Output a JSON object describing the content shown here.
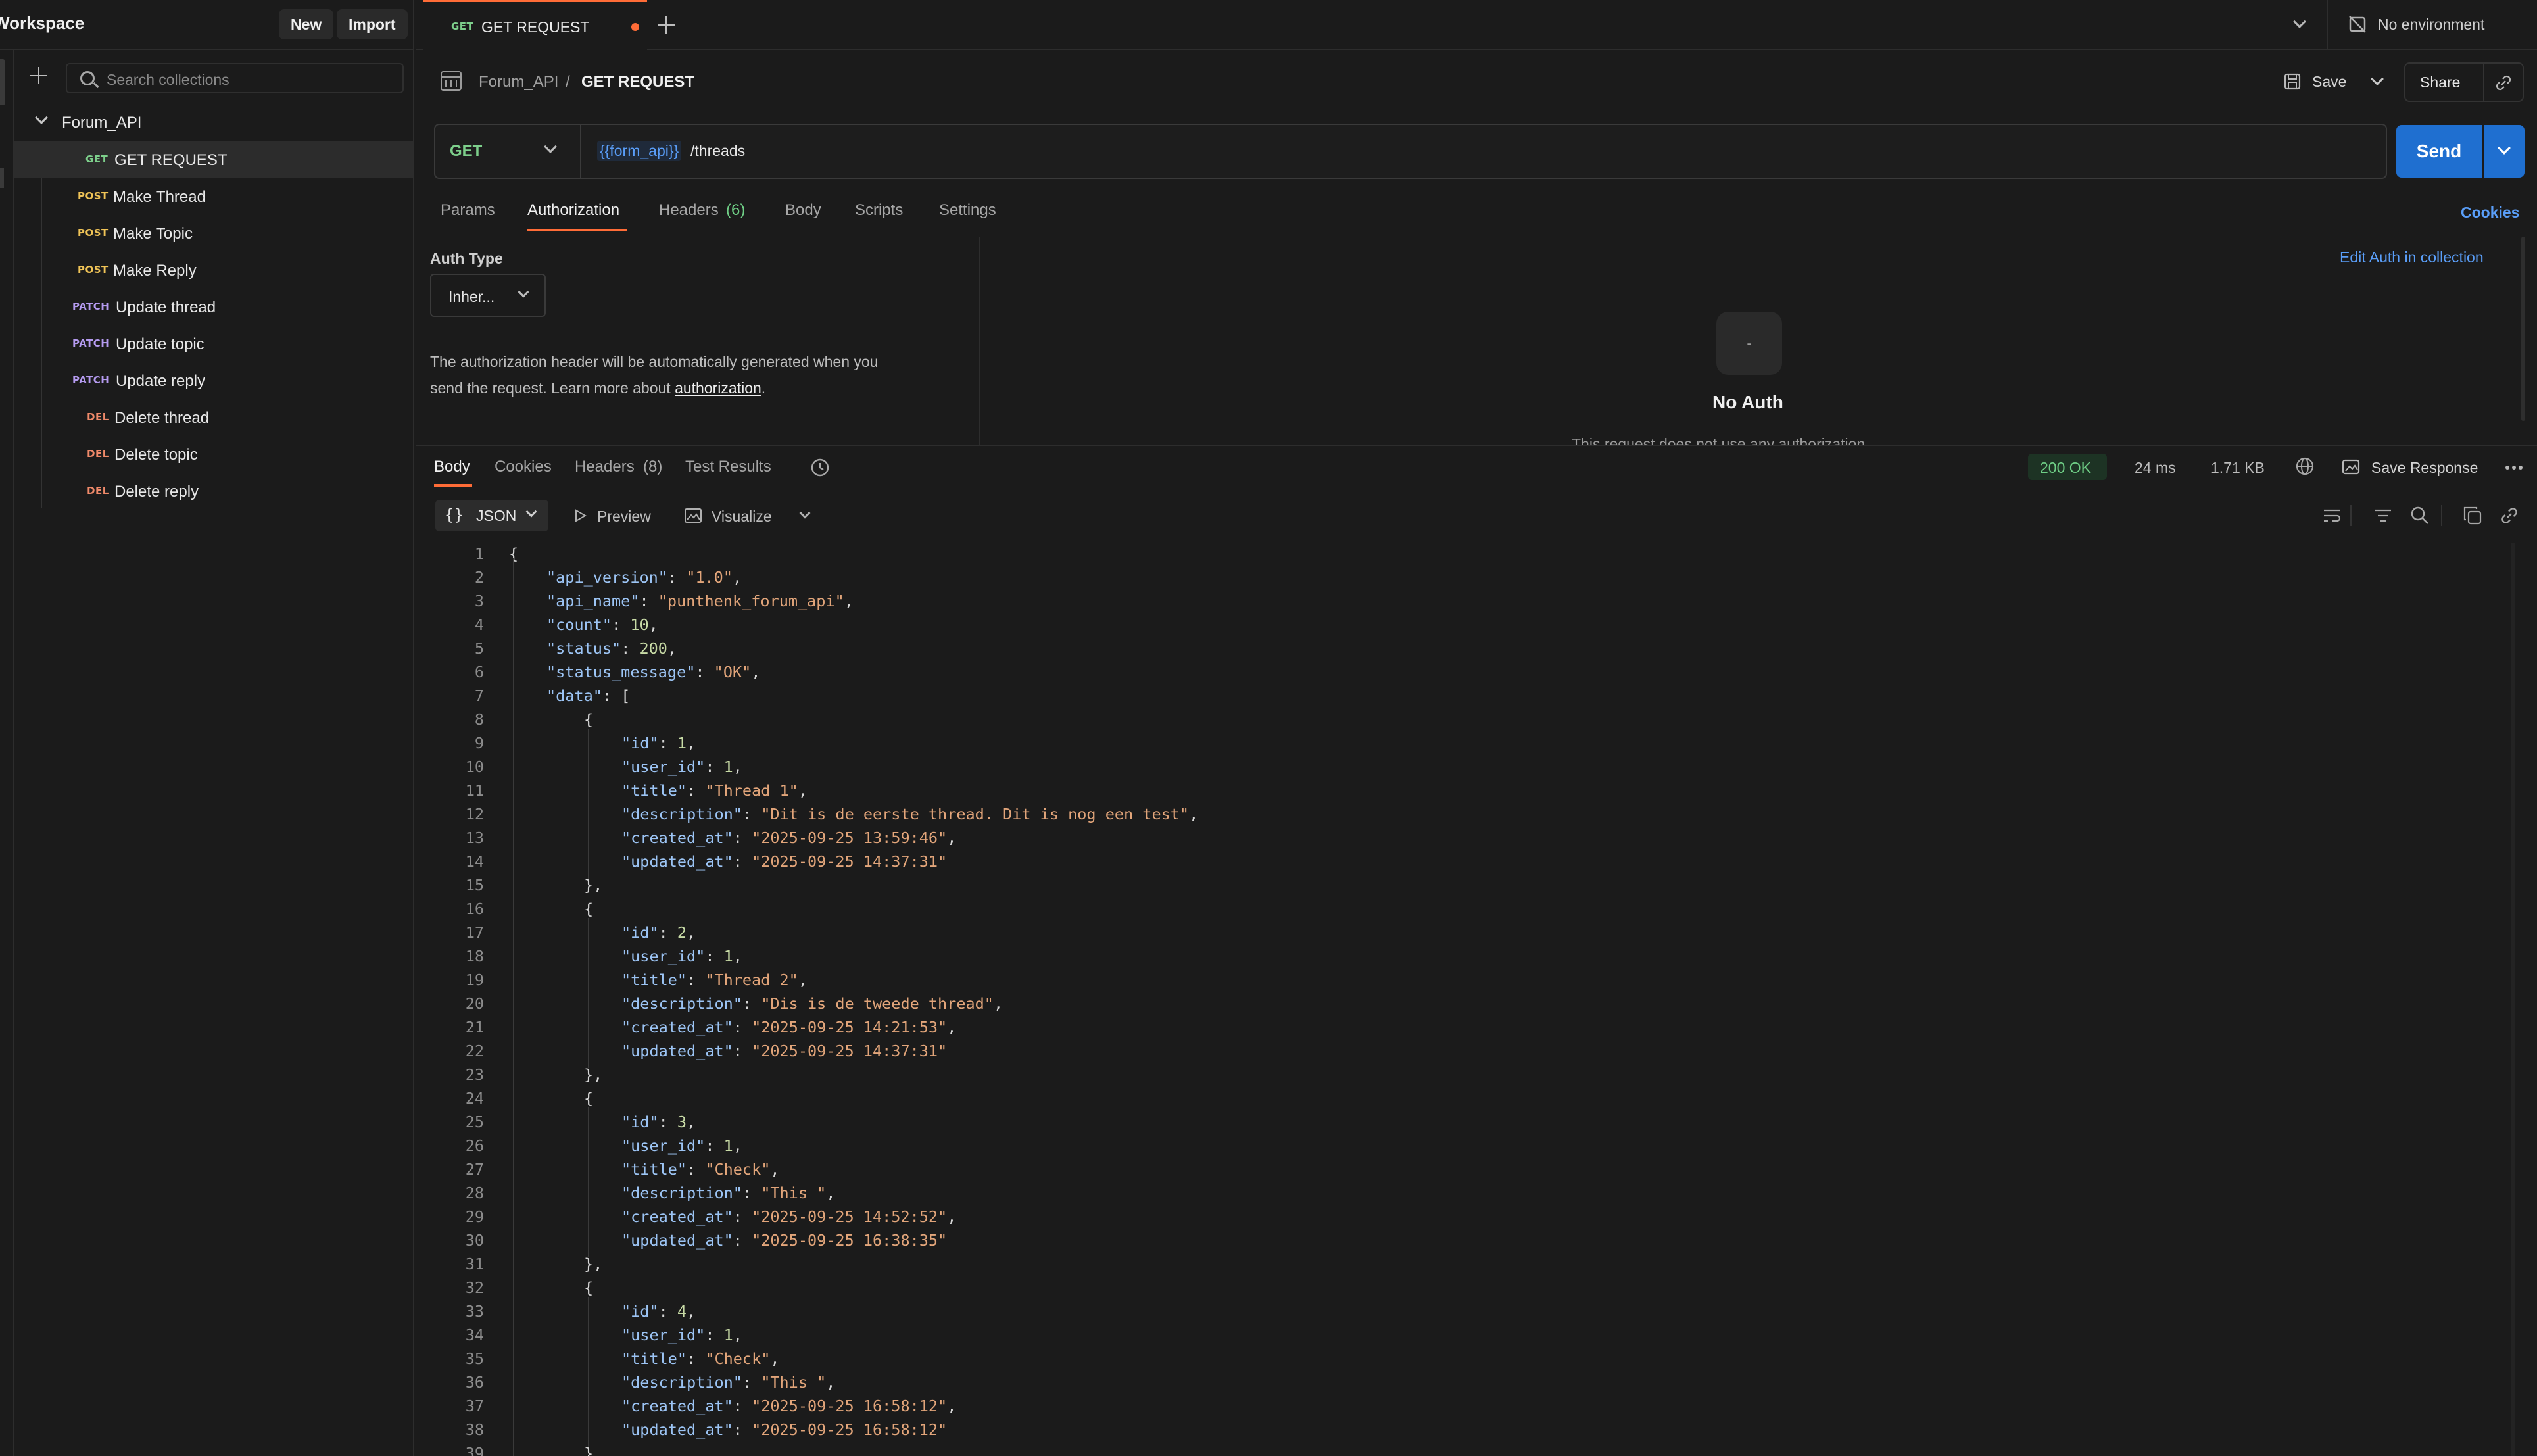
{
  "sidebar": {
    "workspace_title": "Workspace",
    "new_label": "New",
    "import_label": "Import",
    "search_placeholder": "Search collections",
    "collection": {
      "name": "Forum_API",
      "items": [
        {
          "method": "GET",
          "method_color": "#7dcf8b",
          "name": "GET REQUEST",
          "active": true
        },
        {
          "method": "POST",
          "method_color": "#f0c457",
          "name": "Make Thread"
        },
        {
          "method": "POST",
          "method_color": "#f0c457",
          "name": "Make Topic"
        },
        {
          "method": "POST",
          "method_color": "#f0c457",
          "name": "Make Reply"
        },
        {
          "method": "PATCH",
          "method_color": "#b59bf0",
          "name": "Update thread"
        },
        {
          "method": "PATCH",
          "method_color": "#b59bf0",
          "name": "Update topic"
        },
        {
          "method": "PATCH",
          "method_color": "#b59bf0",
          "name": "Update reply"
        },
        {
          "method": "DEL",
          "method_color": "#f08a6a",
          "name": "Delete thread"
        },
        {
          "method": "DEL",
          "method_color": "#f08a6a",
          "name": "Delete topic"
        },
        {
          "method": "DEL",
          "method_color": "#f08a6a",
          "name": "Delete reply"
        }
      ]
    }
  },
  "tabs": {
    "active_method": "GET",
    "active_name": "GET REQUEST",
    "environment": "No environment"
  },
  "request": {
    "breadcrumb_collection": "Forum_API",
    "breadcrumb_separator": "/",
    "title": "GET REQUEST",
    "save_label": "Save",
    "share_label": "Share",
    "method": "GET",
    "url_variable": "{{form_api}}",
    "url_path": "/threads",
    "send_label": "Send",
    "tabs": {
      "params": "Params",
      "authorization": "Authorization",
      "headers": "Headers",
      "headers_count": "(6)",
      "body": "Body",
      "scripts": "Scripts",
      "settings": "Settings"
    },
    "cookies_label": "Cookies"
  },
  "auth": {
    "type_label": "Auth Type",
    "type_value": "Inher...",
    "description": "The authorization header will be automatically generated when you send the request. Learn more about",
    "description_line1": "The authorization header will be automatically generated when you",
    "description_line2": "send the request. Learn more about",
    "learn_link": "authorization",
    "period": ".",
    "edit_link": "Edit Auth in collection",
    "no_auth_title": "No Auth",
    "no_auth_subtitle": "This request does not use any authorization.",
    "no_auth_glyph": "-"
  },
  "response": {
    "tabs": {
      "body": "Body",
      "cookies": "Cookies",
      "headers": "Headers",
      "headers_count": "(8)",
      "test_results": "Test Results"
    },
    "status": "200 OK",
    "status_color": "#6fcf86",
    "time": "24 ms",
    "size": "1.71 KB",
    "save_response": "Save Response",
    "format": "JSON",
    "preview": "Preview",
    "visualize": "Visualize"
  },
  "code_lines": [
    {
      "n": "1",
      "text": "{"
    },
    {
      "n": "2",
      "key": "api_version",
      "val": "\"1.0\"",
      "vt": "str",
      "indent": 1
    },
    {
      "n": "3",
      "key": "api_name",
      "val": "\"punthenk_forum_api\"",
      "vt": "str",
      "indent": 1
    },
    {
      "n": "4",
      "key": "count",
      "val": "10",
      "vt": "num",
      "indent": 1
    },
    {
      "n": "5",
      "key": "status",
      "val": "200",
      "vt": "num",
      "indent": 1
    },
    {
      "n": "6",
      "key": "status_message",
      "val": "\"OK\"",
      "vt": "str",
      "indent": 1
    },
    {
      "n": "7",
      "key": "data",
      "open": "[",
      "indent": 1
    },
    {
      "n": "8",
      "text": "{",
      "indent": 2
    },
    {
      "n": "9",
      "key": "id",
      "val": "1",
      "vt": "num",
      "indent": 3
    },
    {
      "n": "10",
      "key": "user_id",
      "val": "1",
      "vt": "num",
      "indent": 3
    },
    {
      "n": "11",
      "key": "title",
      "val": "\"Thread 1\"",
      "vt": "str",
      "indent": 3
    },
    {
      "n": "12",
      "key": "description",
      "val": "\"Dit is de eerste thread. Dit is nog een test\"",
      "vt": "str",
      "indent": 3
    },
    {
      "n": "13",
      "key": "created_at",
      "val": "\"2025-09-25 13:59:46\"",
      "vt": "str",
      "indent": 3
    },
    {
      "n": "14",
      "key": "updated_at",
      "val": "\"2025-09-25 14:37:31\"",
      "vt": "str",
      "indent": 3,
      "last": true
    },
    {
      "n": "15",
      "text": "},",
      "indent": 2
    },
    {
      "n": "16",
      "text": "{",
      "indent": 2
    },
    {
      "n": "17",
      "key": "id",
      "val": "2",
      "vt": "num",
      "indent": 3
    },
    {
      "n": "18",
      "key": "user_id",
      "val": "1",
      "vt": "num",
      "indent": 3
    },
    {
      "n": "19",
      "key": "title",
      "val": "\"Thread 2\"",
      "vt": "str",
      "indent": 3
    },
    {
      "n": "20",
      "key": "description",
      "val": "\"Dis is de tweede thread\"",
      "vt": "str",
      "indent": 3
    },
    {
      "n": "21",
      "key": "created_at",
      "val": "\"2025-09-25 14:21:53\"",
      "vt": "str",
      "indent": 3
    },
    {
      "n": "22",
      "key": "updated_at",
      "val": "\"2025-09-25 14:37:31\"",
      "vt": "str",
      "indent": 3,
      "last": true
    },
    {
      "n": "23",
      "text": "},",
      "indent": 2
    },
    {
      "n": "24",
      "text": "{",
      "indent": 2
    },
    {
      "n": "25",
      "key": "id",
      "val": "3",
      "vt": "num",
      "indent": 3
    },
    {
      "n": "26",
      "key": "user_id",
      "val": "1",
      "vt": "num",
      "indent": 3
    },
    {
      "n": "27",
      "key": "title",
      "val": "\"Check\"",
      "vt": "str",
      "indent": 3
    },
    {
      "n": "28",
      "key": "description",
      "val": "\"This \"",
      "vt": "str",
      "indent": 3
    },
    {
      "n": "29",
      "key": "created_at",
      "val": "\"2025-09-25 14:52:52\"",
      "vt": "str",
      "indent": 3
    },
    {
      "n": "30",
      "key": "updated_at",
      "val": "\"2025-09-25 16:38:35\"",
      "vt": "str",
      "indent": 3,
      "last": true
    },
    {
      "n": "31",
      "text": "},",
      "indent": 2
    },
    {
      "n": "32",
      "text": "{",
      "indent": 2
    },
    {
      "n": "33",
      "key": "id",
      "val": "4",
      "vt": "num",
      "indent": 3
    },
    {
      "n": "34",
      "key": "user_id",
      "val": "1",
      "vt": "num",
      "indent": 3
    },
    {
      "n": "35",
      "key": "title",
      "val": "\"Check\"",
      "vt": "str",
      "indent": 3
    },
    {
      "n": "36",
      "key": "description",
      "val": "\"This \"",
      "vt": "str",
      "indent": 3
    },
    {
      "n": "37",
      "key": "created_at",
      "val": "\"2025-09-25 16:58:12\"",
      "vt": "str",
      "indent": 3
    },
    {
      "n": "38",
      "key": "updated_at",
      "val": "\"2025-09-25 16:58:12\"",
      "vt": "str",
      "indent": 3,
      "last": true
    },
    {
      "n": "39",
      "text": "},",
      "indent": 2
    }
  ]
}
